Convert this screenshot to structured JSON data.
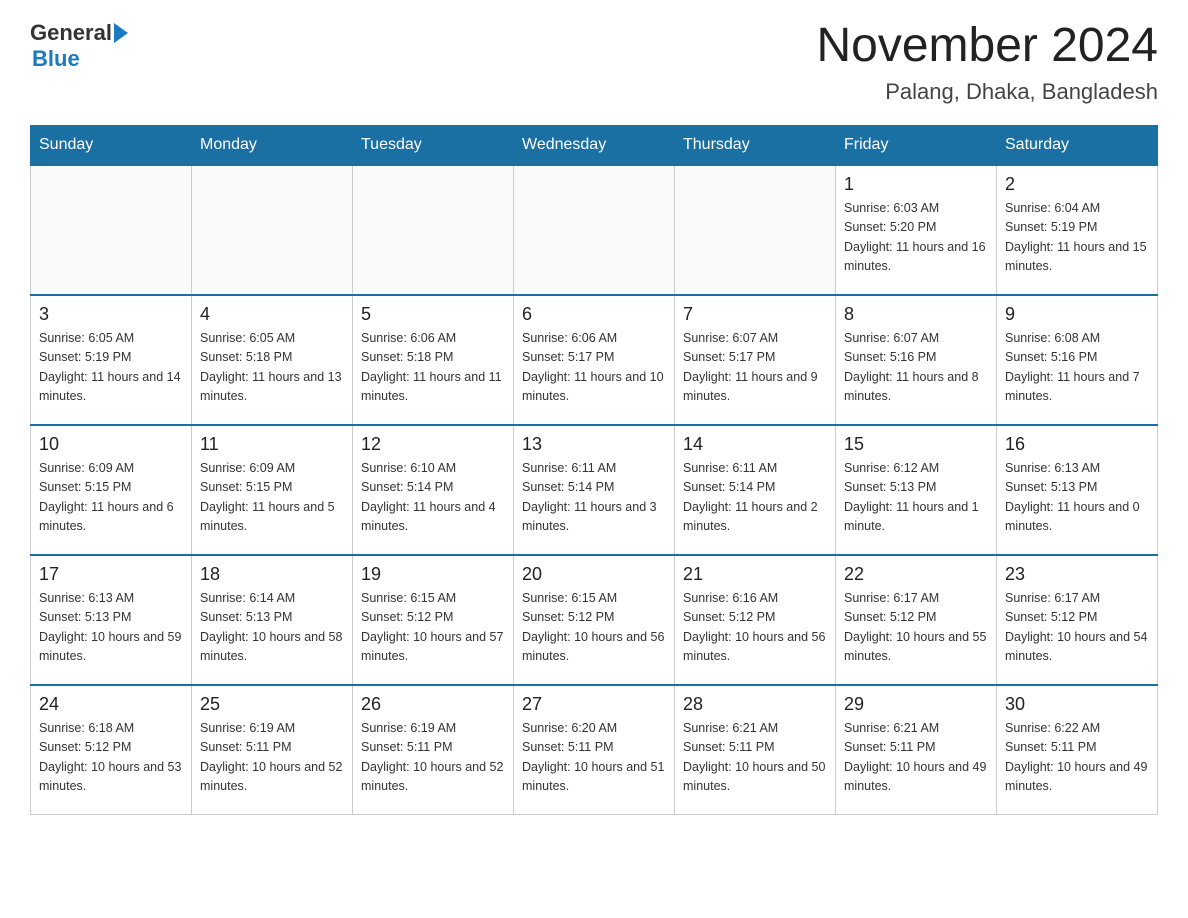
{
  "header": {
    "logo_general": "General",
    "logo_blue": "Blue",
    "title": "November 2024",
    "subtitle": "Palang, Dhaka, Bangladesh"
  },
  "weekdays": [
    "Sunday",
    "Monday",
    "Tuesday",
    "Wednesday",
    "Thursday",
    "Friday",
    "Saturday"
  ],
  "weeks": [
    [
      {
        "day": "",
        "info": ""
      },
      {
        "day": "",
        "info": ""
      },
      {
        "day": "",
        "info": ""
      },
      {
        "day": "",
        "info": ""
      },
      {
        "day": "",
        "info": ""
      },
      {
        "day": "1",
        "info": "Sunrise: 6:03 AM\nSunset: 5:20 PM\nDaylight: 11 hours and 16 minutes."
      },
      {
        "day": "2",
        "info": "Sunrise: 6:04 AM\nSunset: 5:19 PM\nDaylight: 11 hours and 15 minutes."
      }
    ],
    [
      {
        "day": "3",
        "info": "Sunrise: 6:05 AM\nSunset: 5:19 PM\nDaylight: 11 hours and 14 minutes."
      },
      {
        "day": "4",
        "info": "Sunrise: 6:05 AM\nSunset: 5:18 PM\nDaylight: 11 hours and 13 minutes."
      },
      {
        "day": "5",
        "info": "Sunrise: 6:06 AM\nSunset: 5:18 PM\nDaylight: 11 hours and 11 minutes."
      },
      {
        "day": "6",
        "info": "Sunrise: 6:06 AM\nSunset: 5:17 PM\nDaylight: 11 hours and 10 minutes."
      },
      {
        "day": "7",
        "info": "Sunrise: 6:07 AM\nSunset: 5:17 PM\nDaylight: 11 hours and 9 minutes."
      },
      {
        "day": "8",
        "info": "Sunrise: 6:07 AM\nSunset: 5:16 PM\nDaylight: 11 hours and 8 minutes."
      },
      {
        "day": "9",
        "info": "Sunrise: 6:08 AM\nSunset: 5:16 PM\nDaylight: 11 hours and 7 minutes."
      }
    ],
    [
      {
        "day": "10",
        "info": "Sunrise: 6:09 AM\nSunset: 5:15 PM\nDaylight: 11 hours and 6 minutes."
      },
      {
        "day": "11",
        "info": "Sunrise: 6:09 AM\nSunset: 5:15 PM\nDaylight: 11 hours and 5 minutes."
      },
      {
        "day": "12",
        "info": "Sunrise: 6:10 AM\nSunset: 5:14 PM\nDaylight: 11 hours and 4 minutes."
      },
      {
        "day": "13",
        "info": "Sunrise: 6:11 AM\nSunset: 5:14 PM\nDaylight: 11 hours and 3 minutes."
      },
      {
        "day": "14",
        "info": "Sunrise: 6:11 AM\nSunset: 5:14 PM\nDaylight: 11 hours and 2 minutes."
      },
      {
        "day": "15",
        "info": "Sunrise: 6:12 AM\nSunset: 5:13 PM\nDaylight: 11 hours and 1 minute."
      },
      {
        "day": "16",
        "info": "Sunrise: 6:13 AM\nSunset: 5:13 PM\nDaylight: 11 hours and 0 minutes."
      }
    ],
    [
      {
        "day": "17",
        "info": "Sunrise: 6:13 AM\nSunset: 5:13 PM\nDaylight: 10 hours and 59 minutes."
      },
      {
        "day": "18",
        "info": "Sunrise: 6:14 AM\nSunset: 5:13 PM\nDaylight: 10 hours and 58 minutes."
      },
      {
        "day": "19",
        "info": "Sunrise: 6:15 AM\nSunset: 5:12 PM\nDaylight: 10 hours and 57 minutes."
      },
      {
        "day": "20",
        "info": "Sunrise: 6:15 AM\nSunset: 5:12 PM\nDaylight: 10 hours and 56 minutes."
      },
      {
        "day": "21",
        "info": "Sunrise: 6:16 AM\nSunset: 5:12 PM\nDaylight: 10 hours and 56 minutes."
      },
      {
        "day": "22",
        "info": "Sunrise: 6:17 AM\nSunset: 5:12 PM\nDaylight: 10 hours and 55 minutes."
      },
      {
        "day": "23",
        "info": "Sunrise: 6:17 AM\nSunset: 5:12 PM\nDaylight: 10 hours and 54 minutes."
      }
    ],
    [
      {
        "day": "24",
        "info": "Sunrise: 6:18 AM\nSunset: 5:12 PM\nDaylight: 10 hours and 53 minutes."
      },
      {
        "day": "25",
        "info": "Sunrise: 6:19 AM\nSunset: 5:11 PM\nDaylight: 10 hours and 52 minutes."
      },
      {
        "day": "26",
        "info": "Sunrise: 6:19 AM\nSunset: 5:11 PM\nDaylight: 10 hours and 52 minutes."
      },
      {
        "day": "27",
        "info": "Sunrise: 6:20 AM\nSunset: 5:11 PM\nDaylight: 10 hours and 51 minutes."
      },
      {
        "day": "28",
        "info": "Sunrise: 6:21 AM\nSunset: 5:11 PM\nDaylight: 10 hours and 50 minutes."
      },
      {
        "day": "29",
        "info": "Sunrise: 6:21 AM\nSunset: 5:11 PM\nDaylight: 10 hours and 49 minutes."
      },
      {
        "day": "30",
        "info": "Sunrise: 6:22 AM\nSunset: 5:11 PM\nDaylight: 10 hours and 49 minutes."
      }
    ]
  ]
}
